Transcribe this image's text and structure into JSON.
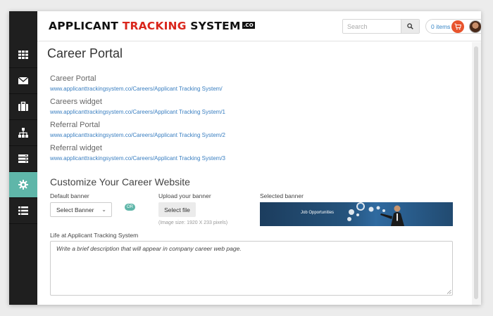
{
  "header": {
    "logo_part1": "APPLICANT ",
    "logo_part2": "TRACKING",
    "logo_part3": " SYSTEM",
    "logo_badge": ".CO",
    "search_placeholder": "Search",
    "cart_items": "0 items"
  },
  "sidebar": {
    "items": [
      {
        "icon": "grid-icon"
      },
      {
        "icon": "envelope-icon"
      },
      {
        "icon": "briefcase-icon"
      },
      {
        "icon": "sitemap-icon"
      },
      {
        "icon": "server-icon"
      },
      {
        "icon": "gear-icon",
        "active": true
      },
      {
        "icon": "list-icon"
      }
    ]
  },
  "main": {
    "title": "Career Portal",
    "links": [
      {
        "label": "Career Portal",
        "url": "www.applicanttrackingsystem.co/Careers/Applicant Tracking System/"
      },
      {
        "label": "Careers widget",
        "url": "www.applicanttrackingsystem.co/Careers/Applicant Tracking System/1"
      },
      {
        "label": "Referral Portal",
        "url": "www.applicanttrackingsystem.co/Careers/Applicant Tracking System/2"
      },
      {
        "label": "Referral widget",
        "url": "www.applicanttrackingsystem.co/Careers/Applicant Tracking System/3"
      }
    ],
    "customize_title": "Customize Your Career Website",
    "default_banner_label": "Default banner",
    "select_value": "Select Banner",
    "or_label": "OR",
    "upload_label": "Upload your banner",
    "select_file_label": "Select file",
    "image_size_hint": "(Image size: 1920 X 233 pixels)",
    "selected_banner_label": "Selected banner",
    "banner_text": "Job Opportunities",
    "life_label": "Life at Applicant Tracking System",
    "description_placeholder": "Write a brief description that will appear in company career web page."
  },
  "colors": {
    "accent": "#5fb6a9",
    "sidebar_bg": "#1f1f1f",
    "link": "#3a7fc1",
    "brand_red": "#d9261c",
    "cart_orange": "#e8542d"
  }
}
